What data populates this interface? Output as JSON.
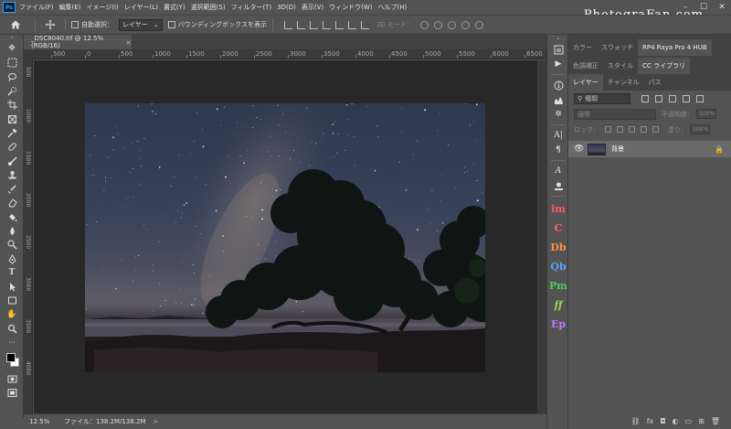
{
  "app": {
    "logo_text": "Ps",
    "brand_watermark": "PhotograFan.com"
  },
  "menu": [
    "ファイル(F)",
    "編集(E)",
    "イメージ(I)",
    "レイヤー(L)",
    "書式(Y)",
    "選択範囲(S)",
    "フィルター(T)",
    "3D(D)",
    "表示(V)",
    "ウィンドウ(W)",
    "ヘルプ(H)"
  ],
  "window_controls": [
    "–",
    "☐",
    "✕"
  ],
  "options_bar": {
    "auto_select_label": "自動選択：",
    "auto_select_value": "レイヤー",
    "show_transform_label": "バウンディングボックスを表示",
    "mode_3d_label": "3D モード："
  },
  "document": {
    "tab_title": "_DSC8040.tif @ 12.5% (RGB/16)",
    "tab_close": "×",
    "ruler_top_labels": [
      "500",
      "0",
      "500",
      "1000",
      "1500",
      "2000",
      "2500",
      "3000",
      "3500",
      "4000",
      "4500",
      "5000",
      "5500",
      "6000",
      "6500"
    ],
    "ruler_left_labels": [
      "500",
      "1000",
      "1500",
      "2000",
      "2500",
      "3000",
      "3500",
      "4000"
    ]
  },
  "status": {
    "zoom": "12.5%",
    "file_info": "ファイル：138.2M/138.2M",
    "arrow": ">"
  },
  "panels": {
    "group1_tabs": [
      "カラー",
      "スウォッチ",
      "RP4 Raya Pro 4 HUB"
    ],
    "group1_active": "RP4 Raya Pro 4 HUB",
    "group2_tabs": [
      "色調補正",
      "スタイル",
      "CC ライブラリ"
    ],
    "group2_active": "CC ライブラリ",
    "group3_tabs": [
      "レイヤー",
      "チャンネル",
      "パス"
    ],
    "group3_active": "レイヤー",
    "layers": {
      "search_placeholder": "種類",
      "blend_mode": "通常",
      "opacity_label": "不透明度：",
      "opacity_value": "100%",
      "lock_label": "ロック：",
      "fill_label": "塗り：",
      "fill_value": "100%",
      "items": [
        {
          "name": "背景",
          "visible_icon": "eye-icon",
          "locked": true
        }
      ],
      "bottom_icons": [
        "link-icon",
        "fx-icon",
        "mask-icon",
        "adjustment-icon",
        "group-icon",
        "new-layer-icon",
        "trash-icon"
      ]
    }
  },
  "extension_icons": [
    {
      "label": "A",
      "color": "#ffffff"
    },
    {
      "label": "im",
      "color": "#ff5a5a"
    },
    {
      "label": "C",
      "color": "#ff6a55"
    },
    {
      "label": "Db",
      "color": "#ff8f3a"
    },
    {
      "label": "Qb",
      "color": "#5aa0ff"
    },
    {
      "label": "Pm",
      "color": "#4ccc55"
    },
    {
      "label": "ff",
      "color": "#9cd64a"
    },
    {
      "label": "Ep",
      "color": "#c17bff"
    }
  ],
  "colors": {
    "menu_bg": "#535353",
    "canvas_bg": "#282828",
    "panel_bg": "#535353",
    "selected_layer": "#6a6a6a"
  }
}
